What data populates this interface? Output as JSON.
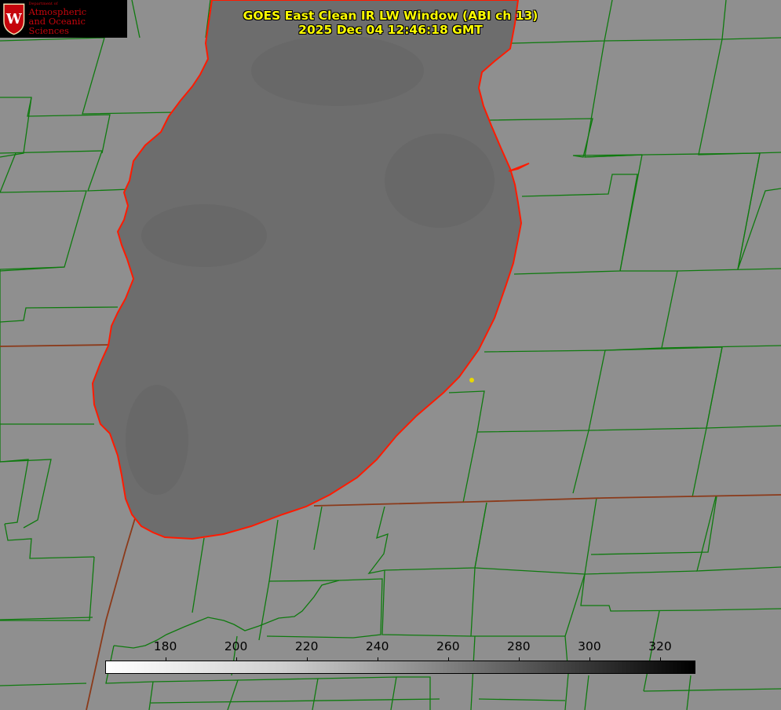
{
  "title": {
    "line1": "GOES East Clean IR LW Window (ABI ch 13)",
    "line2": "2025 Dec 04 12:46:18 GMT"
  },
  "logo": {
    "department": "Department of",
    "line1": "Atmospheric",
    "line2": "and Oceanic Sciences",
    "crest_letter": "W",
    "crest_color": "#c5050c"
  },
  "colorbar": {
    "ticks": [
      "180",
      "200",
      "220",
      "240",
      "260",
      "280",
      "300",
      "320"
    ],
    "min": 163,
    "max": 330,
    "scale": "white (cold) to black (warm)"
  },
  "colors": {
    "land": "#8f8f8f",
    "lake": "#6d6d6d",
    "county_lines": "#0f7a0f",
    "state_lines": "#8b3a1a",
    "shoreline": "#ff1a00",
    "marker": "#e8d800"
  }
}
